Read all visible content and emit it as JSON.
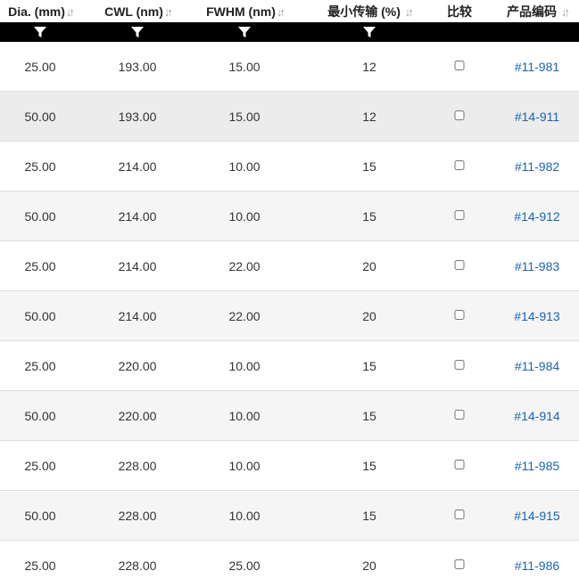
{
  "header": {
    "columns": [
      {
        "label": "Dia. (mm)",
        "sortable": true
      },
      {
        "label": "CWL (nm)",
        "sortable": true
      },
      {
        "label": "FWHM (nm)",
        "sortable": true
      },
      {
        "label": "最小传输 (%)",
        "sortable": true
      },
      {
        "label": "比较",
        "sortable": false
      },
      {
        "label": "产品编码",
        "sortable": true
      }
    ],
    "sort_glyph": "↓↑"
  },
  "filters": {
    "icon": "filter-funnel-icon",
    "columns": [
      "dia",
      "cwl",
      "fwhm",
      "min_transmission"
    ]
  },
  "rows": [
    {
      "dia": "25.00",
      "cwl": "193.00",
      "fwhm": "15.00",
      "min_t": "12",
      "code": "#11-981"
    },
    {
      "dia": "50.00",
      "cwl": "193.00",
      "fwhm": "15.00",
      "min_t": "12",
      "code": "#14-911"
    },
    {
      "dia": "25.00",
      "cwl": "214.00",
      "fwhm": "10.00",
      "min_t": "15",
      "code": "#11-982"
    },
    {
      "dia": "50.00",
      "cwl": "214.00",
      "fwhm": "10.00",
      "min_t": "15",
      "code": "#14-912"
    },
    {
      "dia": "25.00",
      "cwl": "214.00",
      "fwhm": "22.00",
      "min_t": "20",
      "code": "#11-983"
    },
    {
      "dia": "50.00",
      "cwl": "214.00",
      "fwhm": "22.00",
      "min_t": "20",
      "code": "#14-913"
    },
    {
      "dia": "25.00",
      "cwl": "220.00",
      "fwhm": "10.00",
      "min_t": "15",
      "code": "#11-984"
    },
    {
      "dia": "50.00",
      "cwl": "220.00",
      "fwhm": "10.00",
      "min_t": "15",
      "code": "#14-914"
    },
    {
      "dia": "25.00",
      "cwl": "228.00",
      "fwhm": "10.00",
      "min_t": "15",
      "code": "#11-985"
    },
    {
      "dia": "50.00",
      "cwl": "228.00",
      "fwhm": "10.00",
      "min_t": "15",
      "code": "#14-915"
    },
    {
      "dia": "25.00",
      "cwl": "228.00",
      "fwhm": "25.00",
      "min_t": "20",
      "code": "#11-986"
    }
  ],
  "colors": {
    "link": "#1a64b0",
    "filter_bar": "#000000",
    "row_alt": "#f5f5f5",
    "row_hover": "#ececec",
    "sort_icon": "#9a9a9a"
  }
}
